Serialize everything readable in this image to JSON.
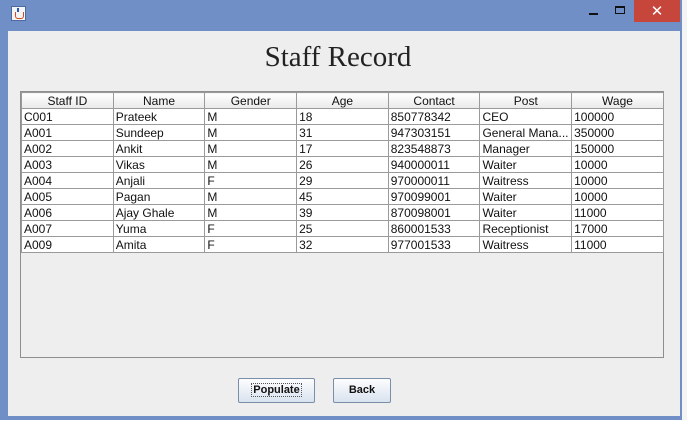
{
  "window": {
    "title": "",
    "close_glyph": "✕"
  },
  "page_title": "Staff Record",
  "table": {
    "columns": [
      "Staff ID",
      "Name",
      "Gender",
      "Age",
      "Contact",
      "Post",
      "Wage"
    ],
    "rows": [
      [
        "C001",
        "Prateek",
        "M",
        "18",
        "850778342",
        "CEO",
        "100000"
      ],
      [
        "A001",
        "Sundeep",
        "M",
        "31",
        "947303151",
        "General Mana...",
        "350000"
      ],
      [
        "A002",
        "Ankit",
        "M",
        "17",
        "823548873",
        "Manager",
        "150000"
      ],
      [
        "A003",
        "Vikas",
        "M",
        "26",
        "940000011",
        "Waiter",
        "10000"
      ],
      [
        "A004",
        "Anjali",
        "F",
        "29",
        "970000011",
        "Waitress",
        "10000"
      ],
      [
        "A005",
        "Pagan",
        "M",
        "45",
        "970099001",
        "Waiter",
        "10000"
      ],
      [
        "A006",
        "Ajay Ghale",
        "M",
        "39",
        "870098001",
        "Waiter",
        "11000"
      ],
      [
        "A007",
        "Yuma",
        "F",
        "25",
        "860001533",
        "Receptionist",
        "17000"
      ],
      [
        "A009",
        "Amita",
        "F",
        "32",
        "977001533",
        "Waitress",
        "11000"
      ]
    ]
  },
  "buttons": {
    "populate": "Populate",
    "back": "Back"
  },
  "colors": {
    "window_frame": "#6f8fc6",
    "client_bg": "#eeeeee",
    "close_button": "#c7463c"
  }
}
